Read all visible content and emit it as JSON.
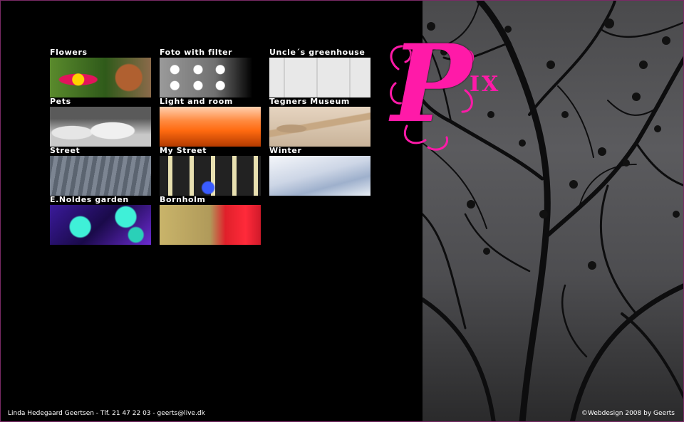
{
  "logo": {
    "big_letter": "P",
    "suffix": "IX"
  },
  "gallery": [
    {
      "label": "Flowers"
    },
    {
      "label": "Foto with filter"
    },
    {
      "label": "Uncle´s greenhouse"
    },
    {
      "label": "Pets"
    },
    {
      "label": "Light and room"
    },
    {
      "label": "Tegners Museum"
    },
    {
      "label": "Street"
    },
    {
      "label": "My Street"
    },
    {
      "label": "Winter"
    },
    {
      "label": "E.Noldes garden"
    },
    {
      "label": "Bornholm"
    }
  ],
  "footer": {
    "contact": "Linda Hedegaard Geertsen - Tlf. 21 47 22 03 - geerts@live.dk",
    "credit": "©Webdesign 2008 by Geerts"
  },
  "colors": {
    "accent": "#ff1aa8",
    "border": "#7a2a66",
    "background": "#000000"
  }
}
